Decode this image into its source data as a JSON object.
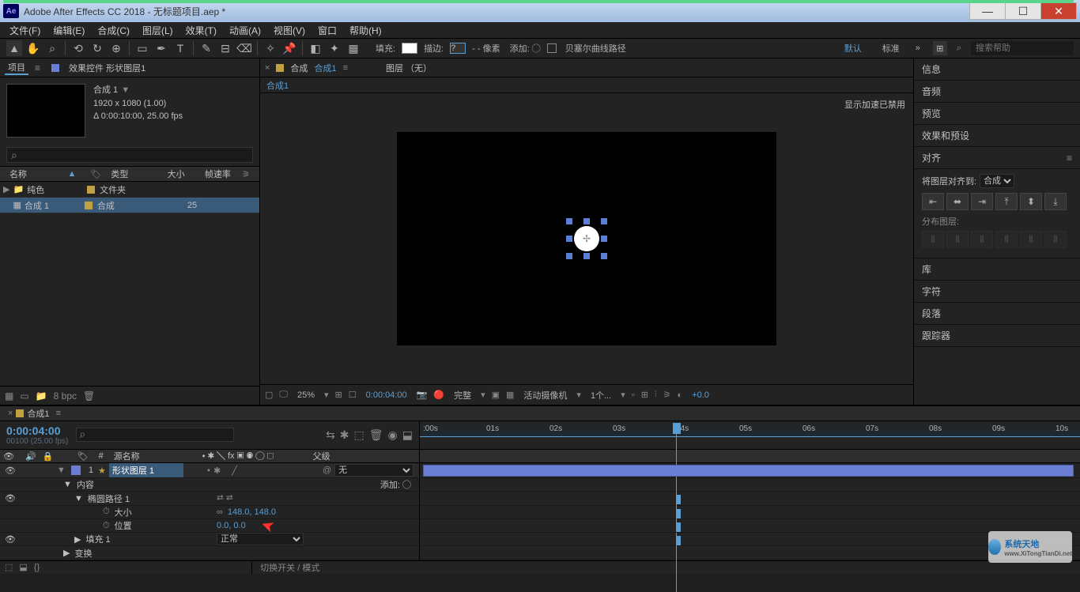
{
  "titlebar": {
    "app_icon_text": "Ae",
    "title": "Adobe After Effects CC 2018 - 无标题项目.aep *"
  },
  "menu": [
    "文件(F)",
    "编辑(E)",
    "合成(C)",
    "图层(L)",
    "效果(T)",
    "动画(A)",
    "视图(V)",
    "窗口",
    "帮助(H)"
  ],
  "toolbar": {
    "fill_label": "填充:",
    "stroke_label": "描边:",
    "stroke_px": "- - 像素",
    "stroke_q": "?",
    "add_label": "添加: ◯",
    "bezier_label": "贝塞尔曲线路径",
    "workspace_default": "默认",
    "workspace_standard": "标准",
    "search_placeholder": "搜索帮助"
  },
  "project": {
    "tab_project": "项目",
    "tab_effects": "效果控件 形状图层1",
    "comp_name": "合成 1",
    "dimensions": "1920 x 1080 (1.00)",
    "duration_fps": "Δ 0:00:10:00, 25.00 fps",
    "headers": {
      "name": "名称",
      "type": "类型",
      "size": "大小",
      "fps": "帧速率"
    },
    "rows": [
      {
        "name": "纯色",
        "type": "文件夹",
        "size": "",
        "fps": ""
      },
      {
        "name": "合成 1",
        "type": "合成",
        "size": "",
        "fps": "25"
      }
    ],
    "bit_depth": "8 bpc"
  },
  "comp": {
    "tab_comp_layer": "合成",
    "tab_comp_name": "合成1",
    "tab_layer_none": "图层 （无）",
    "subtab": "合成1",
    "notice": "显示加速已禁用",
    "footer": {
      "zoom": "25%",
      "time": "0:00:04:00",
      "quality": "完整",
      "camera": "活动摄像机",
      "views": "1个...",
      "exposure": "+0.0"
    }
  },
  "right_panels": [
    "信息",
    "音频",
    "预览",
    "效果和预设"
  ],
  "align": {
    "title": "对齐",
    "align_to_label": "将图层对齐到:",
    "align_to_value": "合成",
    "distribute_label": "分布图层:"
  },
  "right_panels_2": [
    "库",
    "字符",
    "段落",
    "跟踪器"
  ],
  "timeline": {
    "tab": "合成1",
    "time": "0:00:04:00",
    "frame": "00100 (25.00 fps)",
    "cols": {
      "src": "源名称",
      "parent": "父级",
      "num": "#"
    },
    "switch_label": "切换开关 / 模式",
    "ruler": [
      ":00s",
      "01s",
      "02s",
      "03s",
      "04s",
      "05s",
      "06s",
      "07s",
      "08s",
      "09s",
      "10s"
    ],
    "layer": {
      "num": "1",
      "name": "形状图层 1",
      "parent_none": "无"
    },
    "props": {
      "contents": "内容",
      "add_btn": "添加: ◯",
      "ellipse": "椭圆路径 1",
      "size": "大小",
      "size_val": "148.0, 148.0",
      "position": "位置",
      "position_val": "0.0, 0.0",
      "fill": "填充 1",
      "fill_mode": "正常",
      "transform": "变换"
    }
  },
  "watermark": {
    "line1": "系统天地",
    "line2": "www.XiTongTianDi.net"
  }
}
